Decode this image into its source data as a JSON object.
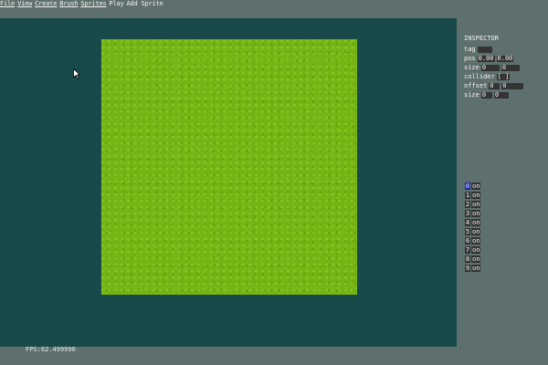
{
  "menu": [
    {
      "label": "File",
      "underline": true
    },
    {
      "label": "View",
      "underline": true
    },
    {
      "label": "Create",
      "underline": true
    },
    {
      "label": "Brush",
      "underline": true
    },
    {
      "label": "Sprites",
      "underline": true
    },
    {
      "label": "Play",
      "underline": false
    },
    {
      "label": "Add Sprite",
      "underline": false
    }
  ],
  "status": {
    "fps": "FPS:62.499996"
  },
  "inspector": {
    "title": "INSPECTOR",
    "tag_label": "tag",
    "tag_value": "",
    "pos_label": "pos",
    "pos_x": "0.00",
    "pos_y": "0.00",
    "size_label": "size",
    "size_w": "0",
    "size_h": "0",
    "collider_label": "collider",
    "collider_checkbox": "[ ]",
    "offset_label": "offset",
    "offset_x": "0",
    "offset_y": "0",
    "collider_size_label": "size",
    "collider_size_w": "0",
    "collider_size_h": "0"
  },
  "layers": [
    {
      "num": "0",
      "toggle": "on",
      "active": true
    },
    {
      "num": "1",
      "toggle": "on",
      "active": false
    },
    {
      "num": "2",
      "toggle": "on",
      "active": false
    },
    {
      "num": "3",
      "toggle": "on",
      "active": false
    },
    {
      "num": "4",
      "toggle": "on",
      "active": false
    },
    {
      "num": "5",
      "toggle": "on",
      "active": false
    },
    {
      "num": "6",
      "toggle": "on",
      "active": false
    },
    {
      "num": "7",
      "toggle": "on",
      "active": false
    },
    {
      "num": "8",
      "toggle": "on",
      "active": false
    },
    {
      "num": "9",
      "toggle": "on",
      "active": false
    }
  ],
  "colors": {
    "background": "#5e706d",
    "viewport": "#184a49",
    "grass": "#74b515",
    "field": "#343434",
    "active_layer": "#1b27a6"
  }
}
